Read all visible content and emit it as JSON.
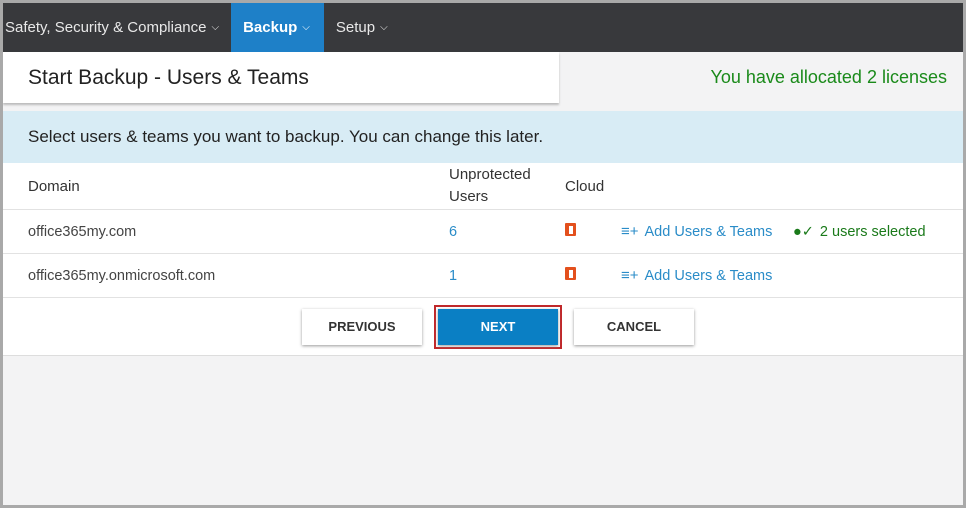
{
  "nav": {
    "items": [
      {
        "label": "Safety, Security & Compliance"
      },
      {
        "label": "Backup"
      },
      {
        "label": "Setup"
      }
    ]
  },
  "header": {
    "title": "Start Backup - Users & Teams",
    "licenses": "You have allocated 2 licenses"
  },
  "banner": "Select users & teams you want to backup. You can change this later.",
  "table": {
    "headers": {
      "domain": "Domain",
      "unprotected": "Unprotected Users",
      "cloud": "Cloud"
    },
    "rows": [
      {
        "domain": "office365my.com",
        "unprotected": "6",
        "action": "Add Users & Teams",
        "selected": "2 users selected"
      },
      {
        "domain": "office365my.onmicrosoft.com",
        "unprotected": "1",
        "action": "Add Users & Teams"
      }
    ]
  },
  "buttons": {
    "previous": "PREVIOUS",
    "next": "NEXT",
    "cancel": "CANCEL"
  }
}
